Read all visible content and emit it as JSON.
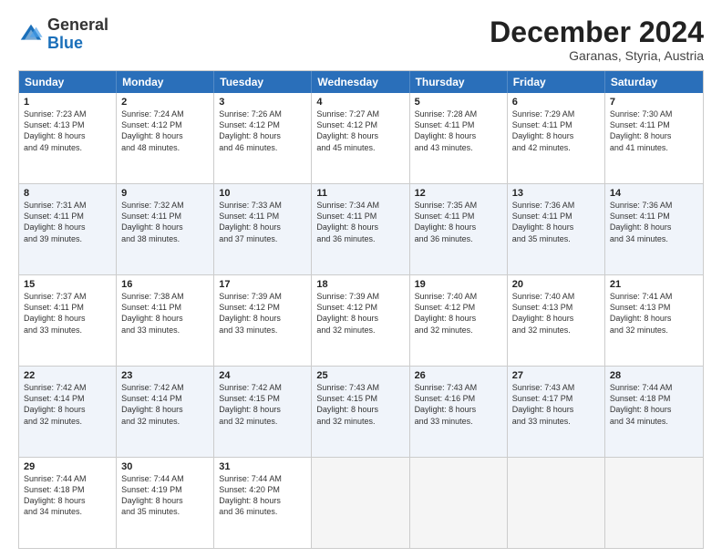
{
  "header": {
    "logo_line1": "General",
    "logo_line2": "Blue",
    "month": "December 2024",
    "location": "Garanas, Styria, Austria"
  },
  "weekdays": [
    "Sunday",
    "Monday",
    "Tuesday",
    "Wednesday",
    "Thursday",
    "Friday",
    "Saturday"
  ],
  "weeks": [
    [
      {
        "day": "1",
        "text": "Sunrise: 7:23 AM\nSunset: 4:13 PM\nDaylight: 8 hours\nand 49 minutes.",
        "empty": false,
        "shaded": false
      },
      {
        "day": "2",
        "text": "Sunrise: 7:24 AM\nSunset: 4:12 PM\nDaylight: 8 hours\nand 48 minutes.",
        "empty": false,
        "shaded": false
      },
      {
        "day": "3",
        "text": "Sunrise: 7:26 AM\nSunset: 4:12 PM\nDaylight: 8 hours\nand 46 minutes.",
        "empty": false,
        "shaded": false
      },
      {
        "day": "4",
        "text": "Sunrise: 7:27 AM\nSunset: 4:12 PM\nDaylight: 8 hours\nand 45 minutes.",
        "empty": false,
        "shaded": false
      },
      {
        "day": "5",
        "text": "Sunrise: 7:28 AM\nSunset: 4:11 PM\nDaylight: 8 hours\nand 43 minutes.",
        "empty": false,
        "shaded": false
      },
      {
        "day": "6",
        "text": "Sunrise: 7:29 AM\nSunset: 4:11 PM\nDaylight: 8 hours\nand 42 minutes.",
        "empty": false,
        "shaded": false
      },
      {
        "day": "7",
        "text": "Sunrise: 7:30 AM\nSunset: 4:11 PM\nDaylight: 8 hours\nand 41 minutes.",
        "empty": false,
        "shaded": false
      }
    ],
    [
      {
        "day": "8",
        "text": "Sunrise: 7:31 AM\nSunset: 4:11 PM\nDaylight: 8 hours\nand 39 minutes.",
        "empty": false,
        "shaded": true
      },
      {
        "day": "9",
        "text": "Sunrise: 7:32 AM\nSunset: 4:11 PM\nDaylight: 8 hours\nand 38 minutes.",
        "empty": false,
        "shaded": true
      },
      {
        "day": "10",
        "text": "Sunrise: 7:33 AM\nSunset: 4:11 PM\nDaylight: 8 hours\nand 37 minutes.",
        "empty": false,
        "shaded": true
      },
      {
        "day": "11",
        "text": "Sunrise: 7:34 AM\nSunset: 4:11 PM\nDaylight: 8 hours\nand 36 minutes.",
        "empty": false,
        "shaded": true
      },
      {
        "day": "12",
        "text": "Sunrise: 7:35 AM\nSunset: 4:11 PM\nDaylight: 8 hours\nand 36 minutes.",
        "empty": false,
        "shaded": true
      },
      {
        "day": "13",
        "text": "Sunrise: 7:36 AM\nSunset: 4:11 PM\nDaylight: 8 hours\nand 35 minutes.",
        "empty": false,
        "shaded": true
      },
      {
        "day": "14",
        "text": "Sunrise: 7:36 AM\nSunset: 4:11 PM\nDaylight: 8 hours\nand 34 minutes.",
        "empty": false,
        "shaded": true
      }
    ],
    [
      {
        "day": "15",
        "text": "Sunrise: 7:37 AM\nSunset: 4:11 PM\nDaylight: 8 hours\nand 33 minutes.",
        "empty": false,
        "shaded": false
      },
      {
        "day": "16",
        "text": "Sunrise: 7:38 AM\nSunset: 4:11 PM\nDaylight: 8 hours\nand 33 minutes.",
        "empty": false,
        "shaded": false
      },
      {
        "day": "17",
        "text": "Sunrise: 7:39 AM\nSunset: 4:12 PM\nDaylight: 8 hours\nand 33 minutes.",
        "empty": false,
        "shaded": false
      },
      {
        "day": "18",
        "text": "Sunrise: 7:39 AM\nSunset: 4:12 PM\nDaylight: 8 hours\nand 32 minutes.",
        "empty": false,
        "shaded": false
      },
      {
        "day": "19",
        "text": "Sunrise: 7:40 AM\nSunset: 4:12 PM\nDaylight: 8 hours\nand 32 minutes.",
        "empty": false,
        "shaded": false
      },
      {
        "day": "20",
        "text": "Sunrise: 7:40 AM\nSunset: 4:13 PM\nDaylight: 8 hours\nand 32 minutes.",
        "empty": false,
        "shaded": false
      },
      {
        "day": "21",
        "text": "Sunrise: 7:41 AM\nSunset: 4:13 PM\nDaylight: 8 hours\nand 32 minutes.",
        "empty": false,
        "shaded": false
      }
    ],
    [
      {
        "day": "22",
        "text": "Sunrise: 7:42 AM\nSunset: 4:14 PM\nDaylight: 8 hours\nand 32 minutes.",
        "empty": false,
        "shaded": true
      },
      {
        "day": "23",
        "text": "Sunrise: 7:42 AM\nSunset: 4:14 PM\nDaylight: 8 hours\nand 32 minutes.",
        "empty": false,
        "shaded": true
      },
      {
        "day": "24",
        "text": "Sunrise: 7:42 AM\nSunset: 4:15 PM\nDaylight: 8 hours\nand 32 minutes.",
        "empty": false,
        "shaded": true
      },
      {
        "day": "25",
        "text": "Sunrise: 7:43 AM\nSunset: 4:15 PM\nDaylight: 8 hours\nand 32 minutes.",
        "empty": false,
        "shaded": true
      },
      {
        "day": "26",
        "text": "Sunrise: 7:43 AM\nSunset: 4:16 PM\nDaylight: 8 hours\nand 33 minutes.",
        "empty": false,
        "shaded": true
      },
      {
        "day": "27",
        "text": "Sunrise: 7:43 AM\nSunset: 4:17 PM\nDaylight: 8 hours\nand 33 minutes.",
        "empty": false,
        "shaded": true
      },
      {
        "day": "28",
        "text": "Sunrise: 7:44 AM\nSunset: 4:18 PM\nDaylight: 8 hours\nand 34 minutes.",
        "empty": false,
        "shaded": true
      }
    ],
    [
      {
        "day": "29",
        "text": "Sunrise: 7:44 AM\nSunset: 4:18 PM\nDaylight: 8 hours\nand 34 minutes.",
        "empty": false,
        "shaded": false
      },
      {
        "day": "30",
        "text": "Sunrise: 7:44 AM\nSunset: 4:19 PM\nDaylight: 8 hours\nand 35 minutes.",
        "empty": false,
        "shaded": false
      },
      {
        "day": "31",
        "text": "Sunrise: 7:44 AM\nSunset: 4:20 PM\nDaylight: 8 hours\nand 36 minutes.",
        "empty": false,
        "shaded": false
      },
      {
        "day": "",
        "text": "",
        "empty": true,
        "shaded": false
      },
      {
        "day": "",
        "text": "",
        "empty": true,
        "shaded": false
      },
      {
        "day": "",
        "text": "",
        "empty": true,
        "shaded": false
      },
      {
        "day": "",
        "text": "",
        "empty": true,
        "shaded": false
      }
    ]
  ]
}
